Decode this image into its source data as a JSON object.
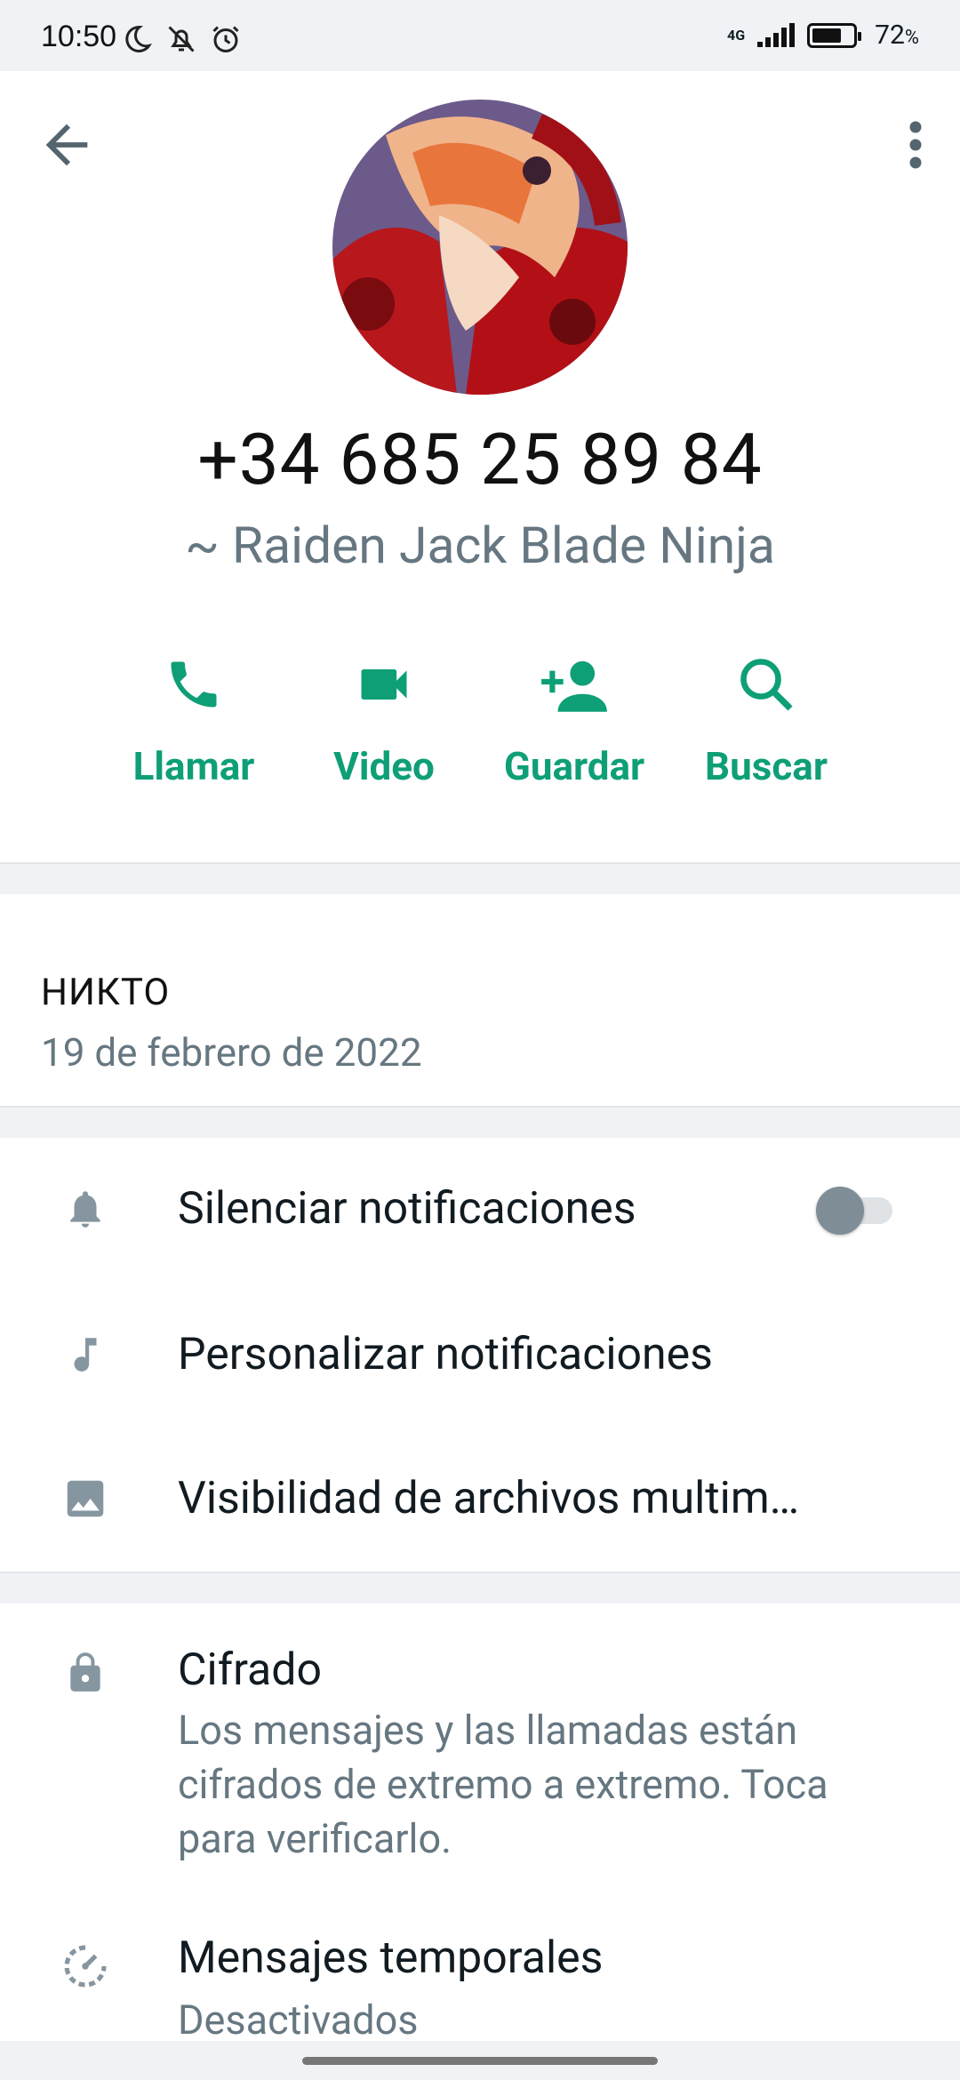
{
  "status_bar": {
    "time": "10:50",
    "network": "4G",
    "battery": "72",
    "battery_unit": "%",
    "battery_level": 0.72
  },
  "contact": {
    "phone": "+34 685 25 89 84",
    "push_name": "~ Raiden Jack Blade Ninja"
  },
  "actions": [
    {
      "label": "Llamar",
      "icon": "phone-icon"
    },
    {
      "label": "Video",
      "icon": "video-icon"
    },
    {
      "label": "Guardar",
      "icon": "add-contact-icon"
    },
    {
      "label": "Buscar",
      "icon": "search-icon"
    }
  ],
  "about": {
    "title": "НИКТО",
    "date": "19 de febrero de 2022"
  },
  "settings": {
    "mute_label": "Silenciar notificaciones",
    "mute_enabled": false,
    "custom_label": "Personalizar notificaciones",
    "media_label": "Visibilidad de archivos multim…"
  },
  "security": {
    "encryption_title": "Cifrado",
    "encryption_sub": "Los mensajes y las llamadas están cifrados de extremo a extremo. Toca para verificarlo.",
    "disappearing_title": "Mensajes temporales",
    "disappearing_sub": "Desactivados"
  },
  "colors": {
    "accent": "#0e9f77",
    "secondary_text": "#667781",
    "icon_gray": "#8696a0"
  }
}
